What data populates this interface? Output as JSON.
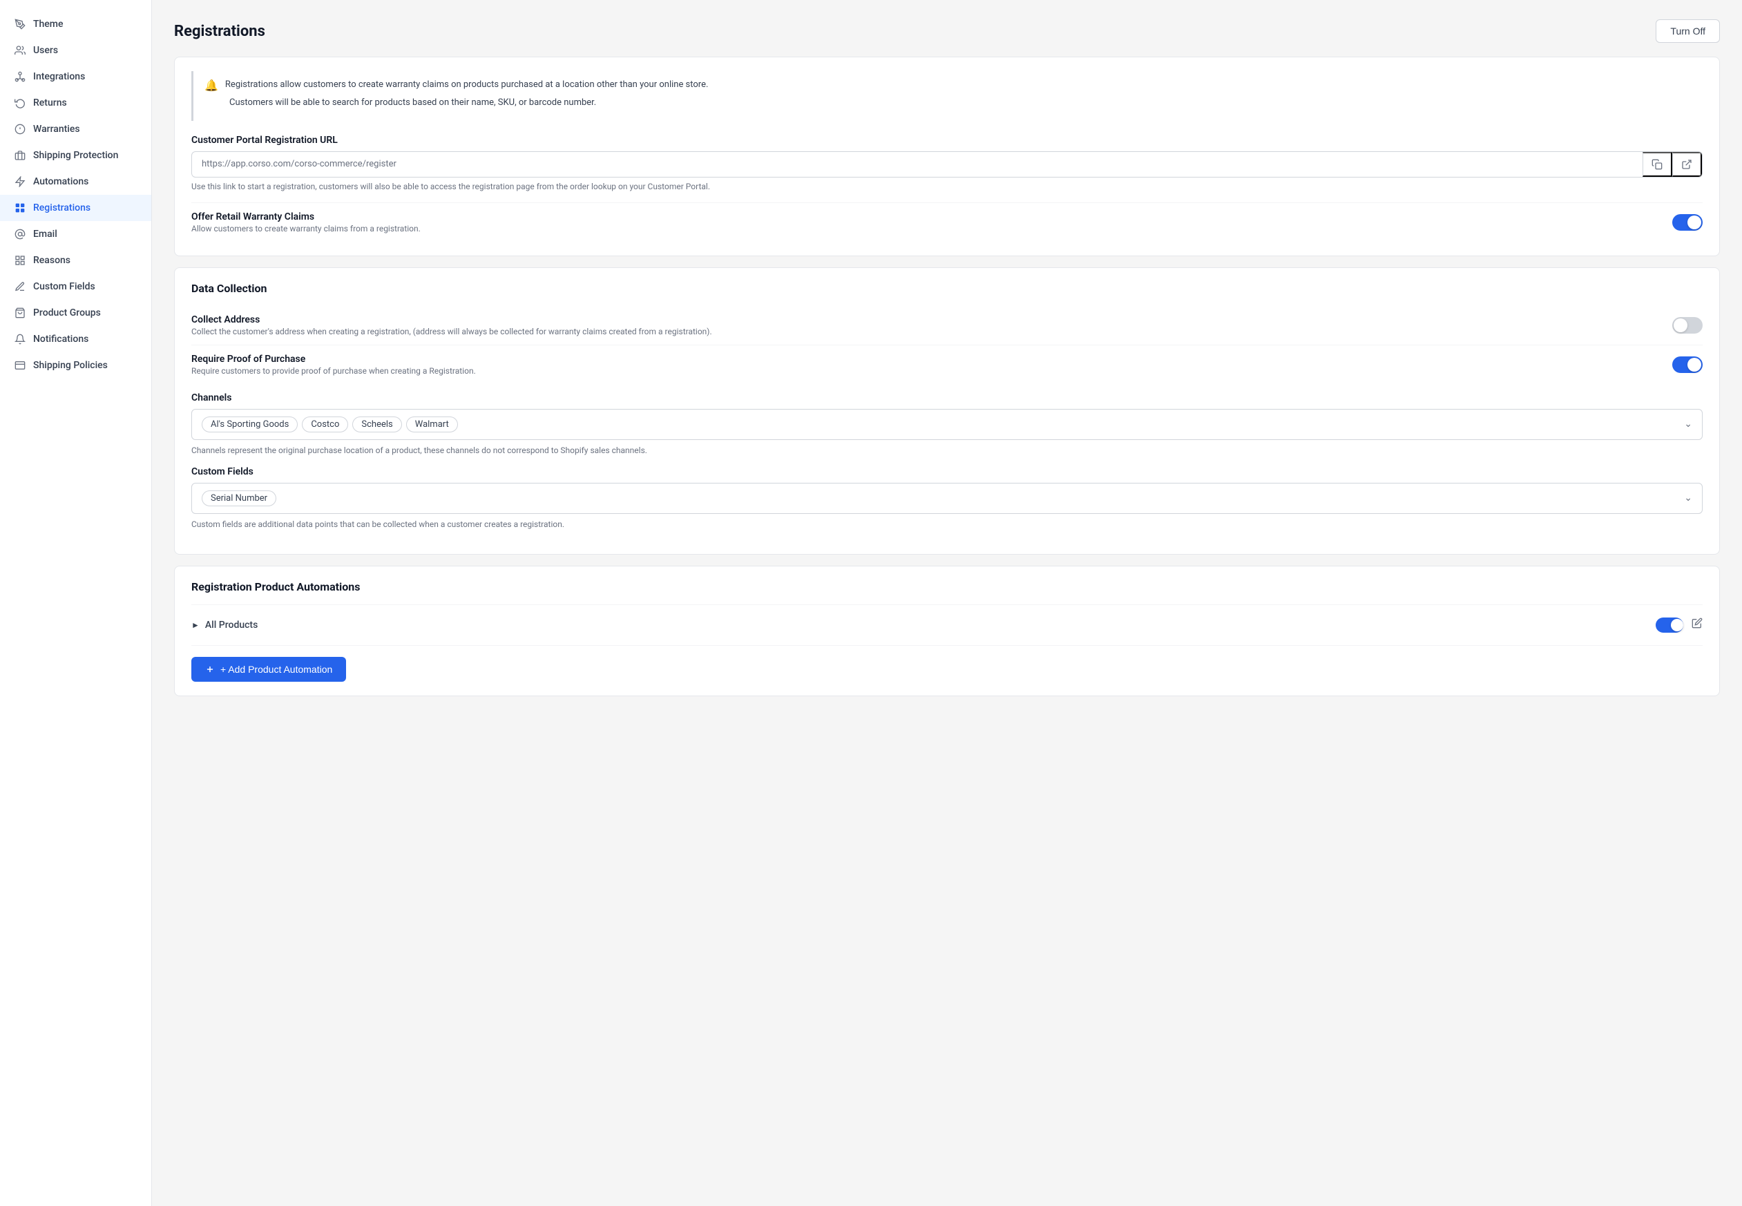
{
  "sidebar": {
    "items": [
      {
        "id": "theme",
        "label": "Theme",
        "icon": "theme",
        "active": false
      },
      {
        "id": "users",
        "label": "Users",
        "icon": "users",
        "active": false
      },
      {
        "id": "integrations",
        "label": "Integrations",
        "icon": "integrations",
        "active": false
      },
      {
        "id": "returns",
        "label": "Returns",
        "icon": "returns",
        "active": false
      },
      {
        "id": "warranties",
        "label": "Warranties",
        "icon": "warranties",
        "active": false
      },
      {
        "id": "shipping-protection",
        "label": "Shipping Protection",
        "icon": "shipping-protection",
        "active": false
      },
      {
        "id": "automations",
        "label": "Automations",
        "icon": "automations",
        "active": false
      },
      {
        "id": "registrations",
        "label": "Registrations",
        "icon": "registrations",
        "active": true
      },
      {
        "id": "email",
        "label": "Email",
        "icon": "email",
        "active": false
      },
      {
        "id": "reasons",
        "label": "Reasons",
        "icon": "reasons",
        "active": false
      },
      {
        "id": "custom-fields",
        "label": "Custom Fields",
        "icon": "custom-fields",
        "active": false
      },
      {
        "id": "product-groups",
        "label": "Product Groups",
        "icon": "product-groups",
        "active": false
      },
      {
        "id": "notifications",
        "label": "Notifications",
        "icon": "notifications",
        "active": false
      },
      {
        "id": "shipping-policies",
        "label": "Shipping Policies",
        "icon": "shipping-policies",
        "active": false
      }
    ]
  },
  "page": {
    "title": "Registrations",
    "turn_off_label": "Turn Off"
  },
  "info_section": {
    "line1": "Registrations allow customers to create warranty claims on products purchased at a location other than your online store.",
    "line2": "Customers will be able to search for products based on their name, SKU, or barcode number."
  },
  "portal_url": {
    "label": "Customer Portal Registration URL",
    "value": "https://app.corso.com/corso-commerce/register",
    "hint": "Use this link to start a registration, customers will also be able to access the registration page from the order lookup on your Customer Portal."
  },
  "offer_retail": {
    "label": "Offer Retail Warranty Claims",
    "desc": "Allow customers to create warranty claims from a registration.",
    "enabled": true
  },
  "data_collection": {
    "title": "Data Collection",
    "collect_address": {
      "label": "Collect Address",
      "desc": "Collect the customer's address when creating a registration, (address will always be collected for warranty claims created from a registration).",
      "enabled": false
    },
    "require_proof": {
      "label": "Require Proof of Purchase",
      "desc": "Require customers to provide proof of purchase when creating a Registration.",
      "enabled": true
    },
    "channels": {
      "label": "Channels",
      "tags": [
        "Al's Sporting Goods",
        "Costco",
        "Scheels",
        "Walmart"
      ],
      "hint": "Channels represent the original purchase location of a product, these channels do not correspond to Shopify sales channels."
    },
    "custom_fields": {
      "label": "Custom Fields",
      "tags": [
        "Serial Number"
      ],
      "hint": "Custom fields are additional data points that can be collected when a customer creates a registration."
    }
  },
  "automations": {
    "title": "Registration Product Automations",
    "items": [
      {
        "label": "All Products",
        "enabled": true
      }
    ],
    "add_button_label": "+ Add Product Automation"
  }
}
